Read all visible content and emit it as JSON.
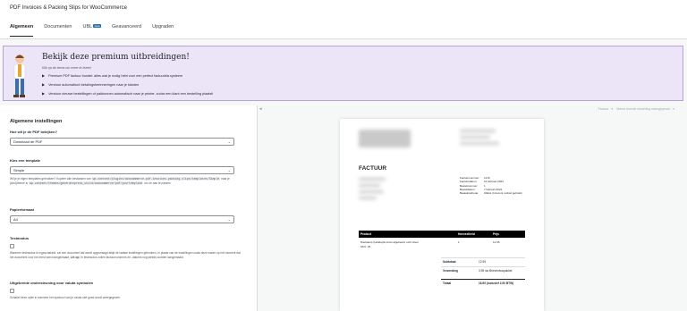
{
  "app": {
    "title": "PDF Invoices & Packing Slips for WooCommerce"
  },
  "tabs": [
    {
      "label": "Algemeen",
      "active": true
    },
    {
      "label": "Documenten"
    },
    {
      "label": "UBL",
      "badge": "beta"
    },
    {
      "label": "Geavanceerd"
    },
    {
      "label": "Upgraden"
    }
  ],
  "banner": {
    "title": "Bekijk deze premium uitbreidingen!",
    "subtitle": "Klik op de items om meer te lezen!",
    "items": [
      "Premium PDF factuur bundel: alles wat je nodig hebt voor een perfect factuurbla systeem",
      "Verstuur automatisch betalingsherinneringen naar je klanten",
      "Verstuur nieuwe bestellingen of pakbonnen automatisch naar je printer, zodra een klant een bestelling plaatst!"
    ]
  },
  "settings": {
    "section_title": "Algemene instellingen",
    "view_pdf": {
      "label": "Hoe wil je de PDF bekijken?",
      "value": "Download de PDF"
    },
    "template": {
      "label": "Kies een template",
      "value": "Simple",
      "help_prefix": "Wil je je eigen templates gebruiken? Kopieer alle bestanden van",
      "path1": "wp-content/plugins/woocommerce-pdf-invoices-packing-slips/templates/Simple",
      "help_mid": "naar je (kind)theme in",
      "path2": "wp-content/themes/generatepress_child/woocommerce/pdf/yourtemplate",
      "help_suffix": "om ze aan te passen"
    },
    "paper": {
      "label": "Papierformaat",
      "value": "A4"
    },
    "testmode": {
      "label": "Testmodus",
      "help": "Wanneer testmodus is ingeschakeld, zal een document dat wordt opgevraagd altijd de laatste instellingen gebruiken, in plaats van de instellingen zoals deze waren op het moment dat het document voor het eerst werd aangemaakt.",
      "help_bold": "Let op:",
      "help_tail": "In testmodus zullen factuurnummers en -datums nog steeds worden aangemaakt."
    },
    "currency": {
      "label": "Uitgebreide ondersteuning voor valuta symbolen",
      "help": "Schakel deze optie in wanneer het symbool van je valuta niet goed wordt weergegeven"
    }
  },
  "preview": {
    "breadcrumb": [
      "Factuur",
      "▾",
      "Meest recente bestelling weergegeven",
      "▾"
    ],
    "invoice_title": "FACTUUR",
    "meta": [
      {
        "k": "Factuurnummer:",
        "v": "1216"
      },
      {
        "k": "Factuurdatum:",
        "v": "12 februari 2024"
      },
      {
        "k": "Bestelnummer:",
        "v": "1"
      },
      {
        "k": "Besteldatum:",
        "v": "7 februari 2024"
      },
      {
        "k": "Betaalmethode:",
        "v": "iDEAL (Inzetu & mobiel gebruik)"
      }
    ],
    "table_head": {
      "product": "Product",
      "qty": "Hoeveelheid",
      "price": "Prijs"
    },
    "row": {
      "product": "Dierlakers (Holidaylie kruis afgebeeld, echt oliver",
      "sku": "SKU: 25",
      "qty": "1",
      "price": "12,95"
    },
    "totals": [
      {
        "k": "Subtotaal",
        "v": "12,95"
      },
      {
        "k": "Verzending",
        "v": "3,95 via Brievenbuspakket"
      },
      {
        "k": "Totaal",
        "v": "16,90 (inclusief 2,90 BTW)",
        "total": true
      }
    ]
  },
  "colors": {
    "banner_bg": "#ece4f7",
    "banner_border": "#b9a1de",
    "accent": "#2271b1"
  }
}
